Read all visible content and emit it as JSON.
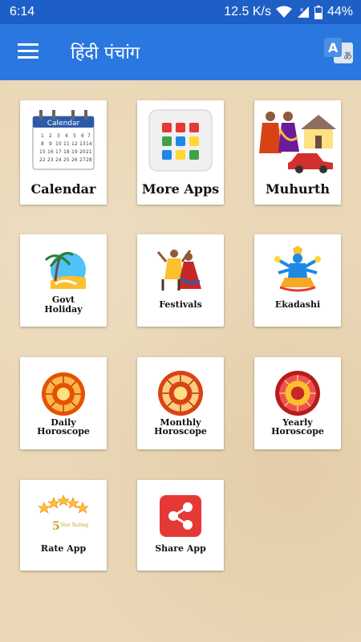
{
  "status": {
    "time": "6:14",
    "network_speed": "12.5 K/s",
    "battery": "44%",
    "icons": [
      "wifi-icon",
      "signal-icon",
      "battery-icon"
    ]
  },
  "app_bar": {
    "title": "हिंदी पंचांग",
    "menu_icon": "menu-icon",
    "translate_icon": "translate-icon",
    "color": "#2a77e0"
  },
  "tiles": [
    {
      "label": "Calendar",
      "icon": "calendar-icon",
      "calendar_header": "Calendar"
    },
    {
      "label": "More Apps",
      "icon": "apps-grid-icon"
    },
    {
      "label": "Muhurth",
      "icon": "muhurth-icon"
    },
    {
      "label_line1": "Govt",
      "label_line2": "Holiday",
      "icon": "beach-icon"
    },
    {
      "label": "Festivals",
      "icon": "festival-dance-icon"
    },
    {
      "label": "Ekadashi",
      "icon": "deity-icon"
    },
    {
      "label_line1": "Daily",
      "label_line2": "Horoscope",
      "icon": "zodiac-wheel-icon"
    },
    {
      "label_line1": "Monthly",
      "label_line2": "Horoscope",
      "icon": "zodiac-wheel-icon"
    },
    {
      "label_line1": "Yearly",
      "label_line2": "Horoscope",
      "icon": "zodiac-wheel-icon"
    },
    {
      "label": "Rate App",
      "icon": "five-star-rating-icon",
      "rating_text_line1": "5",
      "rating_text_line2": "Star Rating"
    },
    {
      "label": "Share App",
      "icon": "share-icon"
    }
  ]
}
